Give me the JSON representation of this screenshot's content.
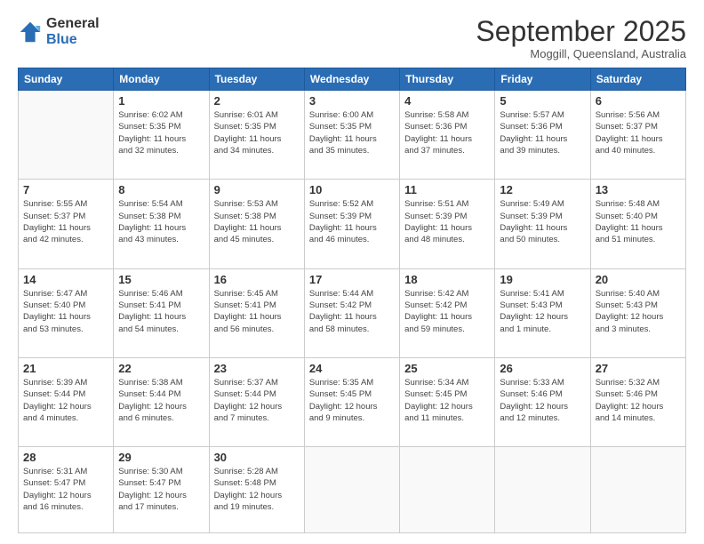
{
  "logo": {
    "general": "General",
    "blue": "Blue"
  },
  "header": {
    "month": "September 2025",
    "location": "Moggill, Queensland, Australia"
  },
  "weekdays": [
    "Sunday",
    "Monday",
    "Tuesday",
    "Wednesday",
    "Thursday",
    "Friday",
    "Saturday"
  ],
  "weeks": [
    [
      {
        "day": "",
        "info": ""
      },
      {
        "day": "1",
        "info": "Sunrise: 6:02 AM\nSunset: 5:35 PM\nDaylight: 11 hours\nand 32 minutes."
      },
      {
        "day": "2",
        "info": "Sunrise: 6:01 AM\nSunset: 5:35 PM\nDaylight: 11 hours\nand 34 minutes."
      },
      {
        "day": "3",
        "info": "Sunrise: 6:00 AM\nSunset: 5:35 PM\nDaylight: 11 hours\nand 35 minutes."
      },
      {
        "day": "4",
        "info": "Sunrise: 5:58 AM\nSunset: 5:36 PM\nDaylight: 11 hours\nand 37 minutes."
      },
      {
        "day": "5",
        "info": "Sunrise: 5:57 AM\nSunset: 5:36 PM\nDaylight: 11 hours\nand 39 minutes."
      },
      {
        "day": "6",
        "info": "Sunrise: 5:56 AM\nSunset: 5:37 PM\nDaylight: 11 hours\nand 40 minutes."
      }
    ],
    [
      {
        "day": "7",
        "info": "Sunrise: 5:55 AM\nSunset: 5:37 PM\nDaylight: 11 hours\nand 42 minutes."
      },
      {
        "day": "8",
        "info": "Sunrise: 5:54 AM\nSunset: 5:38 PM\nDaylight: 11 hours\nand 43 minutes."
      },
      {
        "day": "9",
        "info": "Sunrise: 5:53 AM\nSunset: 5:38 PM\nDaylight: 11 hours\nand 45 minutes."
      },
      {
        "day": "10",
        "info": "Sunrise: 5:52 AM\nSunset: 5:39 PM\nDaylight: 11 hours\nand 46 minutes."
      },
      {
        "day": "11",
        "info": "Sunrise: 5:51 AM\nSunset: 5:39 PM\nDaylight: 11 hours\nand 48 minutes."
      },
      {
        "day": "12",
        "info": "Sunrise: 5:49 AM\nSunset: 5:39 PM\nDaylight: 11 hours\nand 50 minutes."
      },
      {
        "day": "13",
        "info": "Sunrise: 5:48 AM\nSunset: 5:40 PM\nDaylight: 11 hours\nand 51 minutes."
      }
    ],
    [
      {
        "day": "14",
        "info": "Sunrise: 5:47 AM\nSunset: 5:40 PM\nDaylight: 11 hours\nand 53 minutes."
      },
      {
        "day": "15",
        "info": "Sunrise: 5:46 AM\nSunset: 5:41 PM\nDaylight: 11 hours\nand 54 minutes."
      },
      {
        "day": "16",
        "info": "Sunrise: 5:45 AM\nSunset: 5:41 PM\nDaylight: 11 hours\nand 56 minutes."
      },
      {
        "day": "17",
        "info": "Sunrise: 5:44 AM\nSunset: 5:42 PM\nDaylight: 11 hours\nand 58 minutes."
      },
      {
        "day": "18",
        "info": "Sunrise: 5:42 AM\nSunset: 5:42 PM\nDaylight: 11 hours\nand 59 minutes."
      },
      {
        "day": "19",
        "info": "Sunrise: 5:41 AM\nSunset: 5:43 PM\nDaylight: 12 hours\nand 1 minute."
      },
      {
        "day": "20",
        "info": "Sunrise: 5:40 AM\nSunset: 5:43 PM\nDaylight: 12 hours\nand 3 minutes."
      }
    ],
    [
      {
        "day": "21",
        "info": "Sunrise: 5:39 AM\nSunset: 5:44 PM\nDaylight: 12 hours\nand 4 minutes."
      },
      {
        "day": "22",
        "info": "Sunrise: 5:38 AM\nSunset: 5:44 PM\nDaylight: 12 hours\nand 6 minutes."
      },
      {
        "day": "23",
        "info": "Sunrise: 5:37 AM\nSunset: 5:44 PM\nDaylight: 12 hours\nand 7 minutes."
      },
      {
        "day": "24",
        "info": "Sunrise: 5:35 AM\nSunset: 5:45 PM\nDaylight: 12 hours\nand 9 minutes."
      },
      {
        "day": "25",
        "info": "Sunrise: 5:34 AM\nSunset: 5:45 PM\nDaylight: 12 hours\nand 11 minutes."
      },
      {
        "day": "26",
        "info": "Sunrise: 5:33 AM\nSunset: 5:46 PM\nDaylight: 12 hours\nand 12 minutes."
      },
      {
        "day": "27",
        "info": "Sunrise: 5:32 AM\nSunset: 5:46 PM\nDaylight: 12 hours\nand 14 minutes."
      }
    ],
    [
      {
        "day": "28",
        "info": "Sunrise: 5:31 AM\nSunset: 5:47 PM\nDaylight: 12 hours\nand 16 minutes."
      },
      {
        "day": "29",
        "info": "Sunrise: 5:30 AM\nSunset: 5:47 PM\nDaylight: 12 hours\nand 17 minutes."
      },
      {
        "day": "30",
        "info": "Sunrise: 5:28 AM\nSunset: 5:48 PM\nDaylight: 12 hours\nand 19 minutes."
      },
      {
        "day": "",
        "info": ""
      },
      {
        "day": "",
        "info": ""
      },
      {
        "day": "",
        "info": ""
      },
      {
        "day": "",
        "info": ""
      }
    ]
  ]
}
